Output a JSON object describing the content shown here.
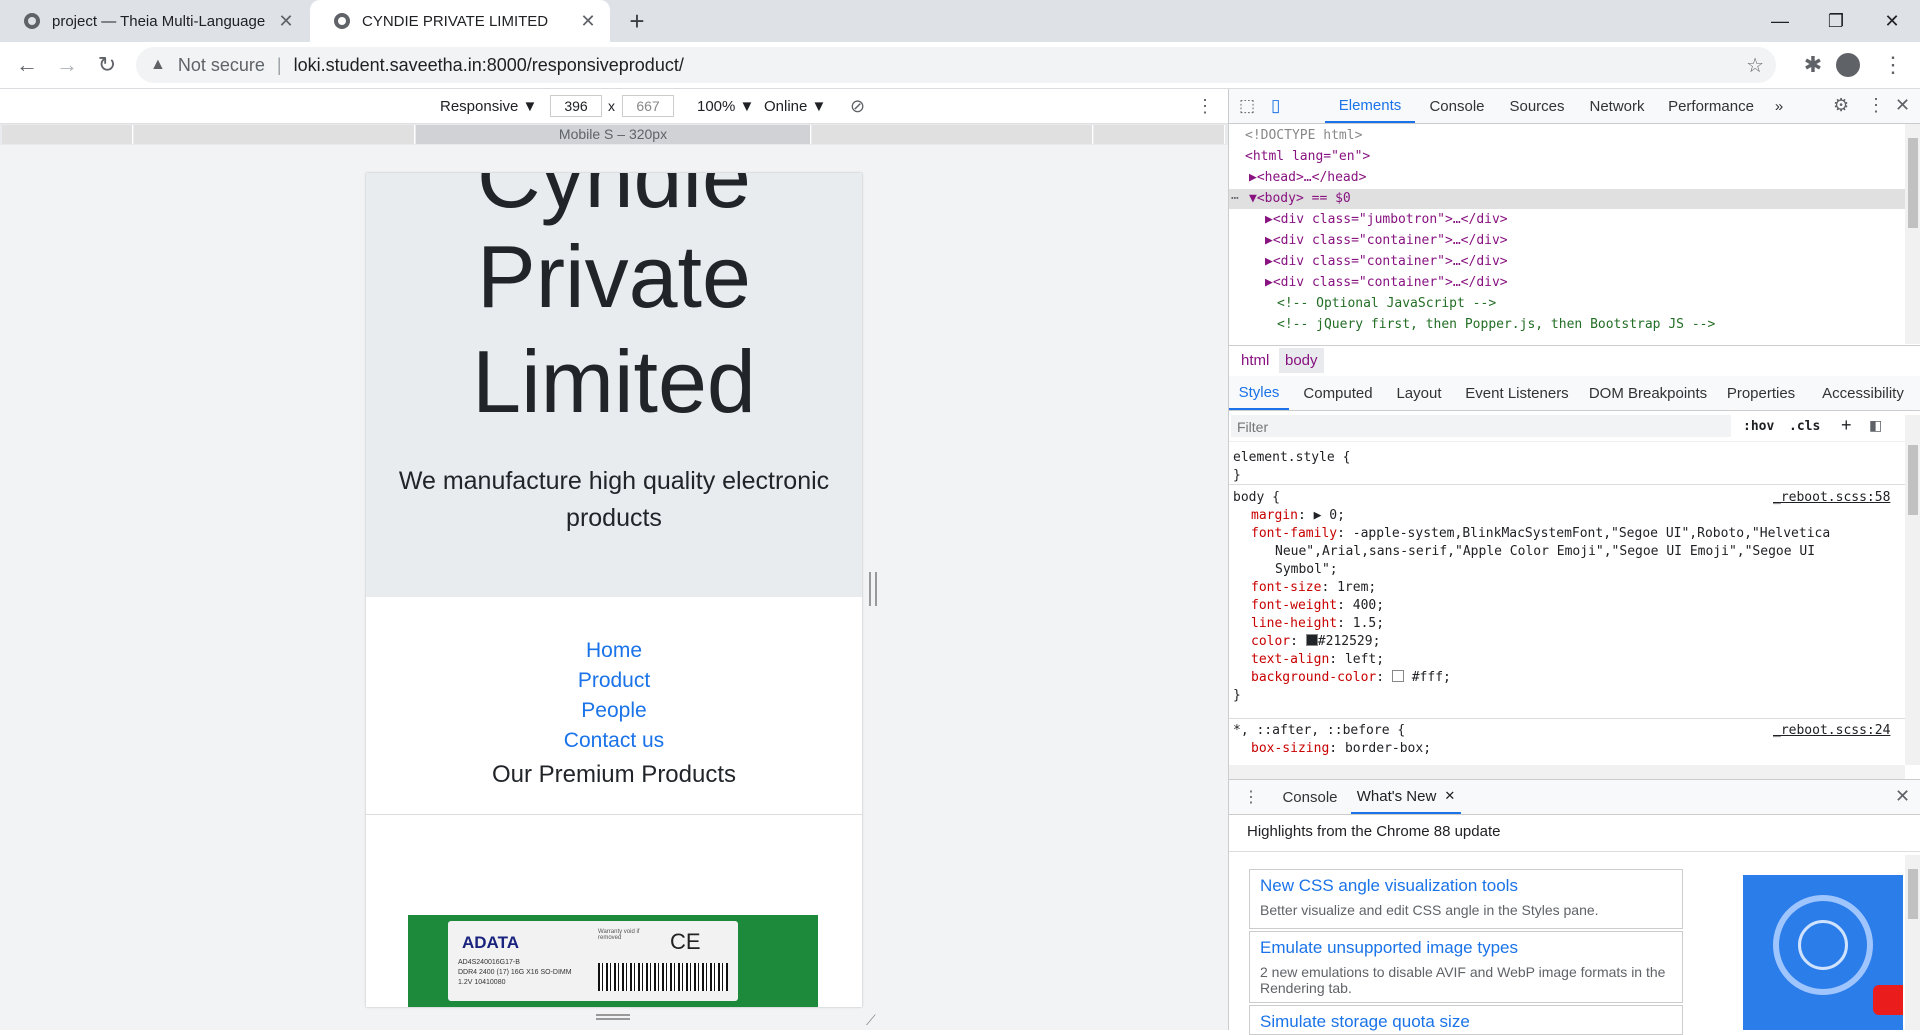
{
  "tabs": [
    {
      "title": "project — Theia Multi-Language"
    },
    {
      "title": "CYNDIE PRIVATE LIMITED"
    }
  ],
  "toolbar": {
    "security_label": "Not secure",
    "url": "loki.student.saveetha.in:8000/responsiveproduct/"
  },
  "device_toolbar": {
    "device": "Responsive ▼",
    "width": "396",
    "times": "x",
    "height": "667",
    "zoom": "100% ▼",
    "throttle": "Online ▼",
    "media_query_label": "Mobile S – 320px"
  },
  "site": {
    "title_line1": "Cyndie",
    "title_line2": "Private",
    "title_line3": "Limited",
    "tagline": "We manufacture high quality electronic products",
    "nav": [
      "Home",
      "Product",
      "People",
      "Contact us"
    ],
    "section_title": "Our Premium Products",
    "product": {
      "brand": "ADATA",
      "model": "AD4S240016G17-B",
      "spec1": "DDR4 2400 (17) 16G X16 SO-DIMM",
      "spec2": "1.2V 10410080",
      "warranty": "Warranty void if removed",
      "marks": "CE"
    }
  },
  "devtools": {
    "main_tabs": [
      "Elements",
      "Console",
      "Sources",
      "Network",
      "Performance",
      "»"
    ],
    "dom_lines": [
      {
        "text": "<!DOCTYPE html>"
      },
      {
        "text": "<html lang=\"en\">"
      },
      {
        "text": "▶<head>…</head>"
      },
      {
        "text": "▼<body> == $0"
      },
      {
        "text": "▶<div class=\"jumbotron\">…</div>"
      },
      {
        "text": "▶<div class=\"container\">…</div>"
      },
      {
        "text": "▶<div class=\"container\">…</div>"
      },
      {
        "text": "▶<div class=\"container\">…</div>"
      },
      {
        "text": "<!-- Optional JavaScript -->"
      },
      {
        "text": "<!-- jQuery first, then Popper.js, then Bootstrap JS -->"
      }
    ],
    "breadcrumbs": [
      "html",
      "body"
    ],
    "sub_tabs": [
      "Styles",
      "Computed",
      "Layout",
      "Event Listeners",
      "DOM Breakpoints",
      "Properties",
      "Accessibility"
    ],
    "filter_placeholder": "Filter",
    "hov": ":hov",
    "cls": ".cls",
    "element_style": "element.style {",
    "close_brace": "}",
    "body_rule": {
      "selector": "body {",
      "source": "_reboot.scss:58",
      "decls": [
        {
          "prop": "margin",
          "val": "▶ 0;"
        },
        {
          "prop": "font-family",
          "val": "-apple-system,BlinkMacSystemFont,\"Segoe UI\",Roboto,\"Helvetica"
        },
        {
          "prop": "",
          "val": "Neue\",Arial,sans-serif,\"Apple Color Emoji\",\"Segoe UI Emoji\",\"Segoe UI"
        },
        {
          "prop": "",
          "val": "Symbol\";"
        },
        {
          "prop": "font-size",
          "val": "1rem;"
        },
        {
          "prop": "font-weight",
          "val": "400;"
        },
        {
          "prop": "line-height",
          "val": "1.5;"
        },
        {
          "prop": "color",
          "val": "#212529;"
        },
        {
          "prop": "text-align",
          "val": "left;"
        },
        {
          "prop": "background-color",
          "val": "#fff;"
        }
      ]
    },
    "star_rule": {
      "selector": "*, ::after, ::before {",
      "source": "_reboot.scss:24",
      "decl_prop": "box-sizing",
      "decl_val": "border-box;"
    },
    "drawer_tabs": [
      "Console",
      "What's New"
    ],
    "whats_new_header": "Highlights from the Chrome 88 update",
    "cards": [
      {
        "title": "New CSS angle visualization tools",
        "desc": "Better visualize and edit CSS angle in the Styles pane."
      },
      {
        "title": "Emulate unsupported image types",
        "desc": "2 new emulations to disable AVIF and WebP image formats in the Rendering tab."
      },
      {
        "title": "Simulate storage quota size",
        "desc": ""
      }
    ],
    "colors": {
      "accent": "#1a73e8",
      "swatch_color": "#212529",
      "swatch_bg": "#ffffff"
    }
  }
}
